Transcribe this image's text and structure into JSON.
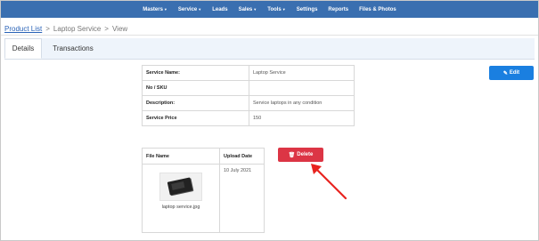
{
  "nav": {
    "items": [
      {
        "label": "Masters",
        "caret": "▼"
      },
      {
        "label": "Service",
        "caret": "▼"
      },
      {
        "label": "Leads",
        "caret": ""
      },
      {
        "label": "Sales",
        "caret": "▼"
      },
      {
        "label": "Tools",
        "caret": "▼"
      },
      {
        "label": "Settings",
        "caret": ""
      },
      {
        "label": "Reports",
        "caret": ""
      },
      {
        "label": "Files & Photos",
        "caret": ""
      }
    ]
  },
  "breadcrumb": {
    "link": "Product List",
    "sep1": ">",
    "current": "Laptop Service",
    "sep2": ">",
    "action": "View"
  },
  "tabs": [
    {
      "label": "Details"
    },
    {
      "label": "Transactions"
    }
  ],
  "details": [
    {
      "label": "Service Name:",
      "value": "Laptop Service"
    },
    {
      "label": "No / SKU",
      "value": ""
    },
    {
      "label": "Description:",
      "value": "Service laptops in any condition"
    },
    {
      "label": "Service Price",
      "value": "150"
    }
  ],
  "files": {
    "headers": {
      "name": "File Name",
      "date": "Upload Date"
    },
    "rows": [
      {
        "filename": "laptop service.jpg",
        "date": "10 July 2021"
      }
    ]
  },
  "buttons": {
    "edit": "Edit",
    "delete": "Delete"
  },
  "colors": {
    "navbar": "#3a6fb0",
    "delete": "#dc3545",
    "edit": "#1a7fe0",
    "arrow": "#e8231f"
  }
}
